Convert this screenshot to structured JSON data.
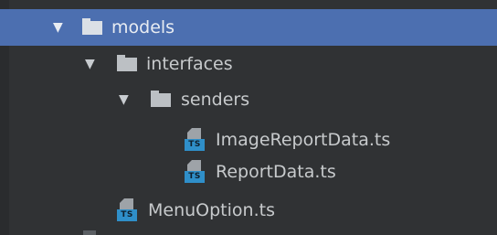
{
  "tree": {
    "items": [
      {
        "label": "models",
        "type": "folder",
        "expanded": true,
        "selected": true
      },
      {
        "label": "interfaces",
        "type": "folder",
        "expanded": true,
        "selected": false
      },
      {
        "label": "senders",
        "type": "folder",
        "expanded": true,
        "selected": false
      },
      {
        "label": "ImageReportData.ts",
        "type": "typescript-file",
        "badge": "TS"
      },
      {
        "label": "ReportData.ts",
        "type": "typescript-file",
        "badge": "TS"
      },
      {
        "label": "MenuOption.ts",
        "type": "typescript-file",
        "badge": "TS"
      }
    ],
    "expand_glyph": "▼"
  },
  "colors": {
    "background": "#303234",
    "selection": "#4c6fb0",
    "text": "#c7cacc",
    "folder": "#bcc0c4",
    "ts_badge": "#2f8fc9"
  },
  "icons": {
    "folder": "folder-icon",
    "file": "typescript-file-icon",
    "expand": "expand-arrow-icon"
  }
}
